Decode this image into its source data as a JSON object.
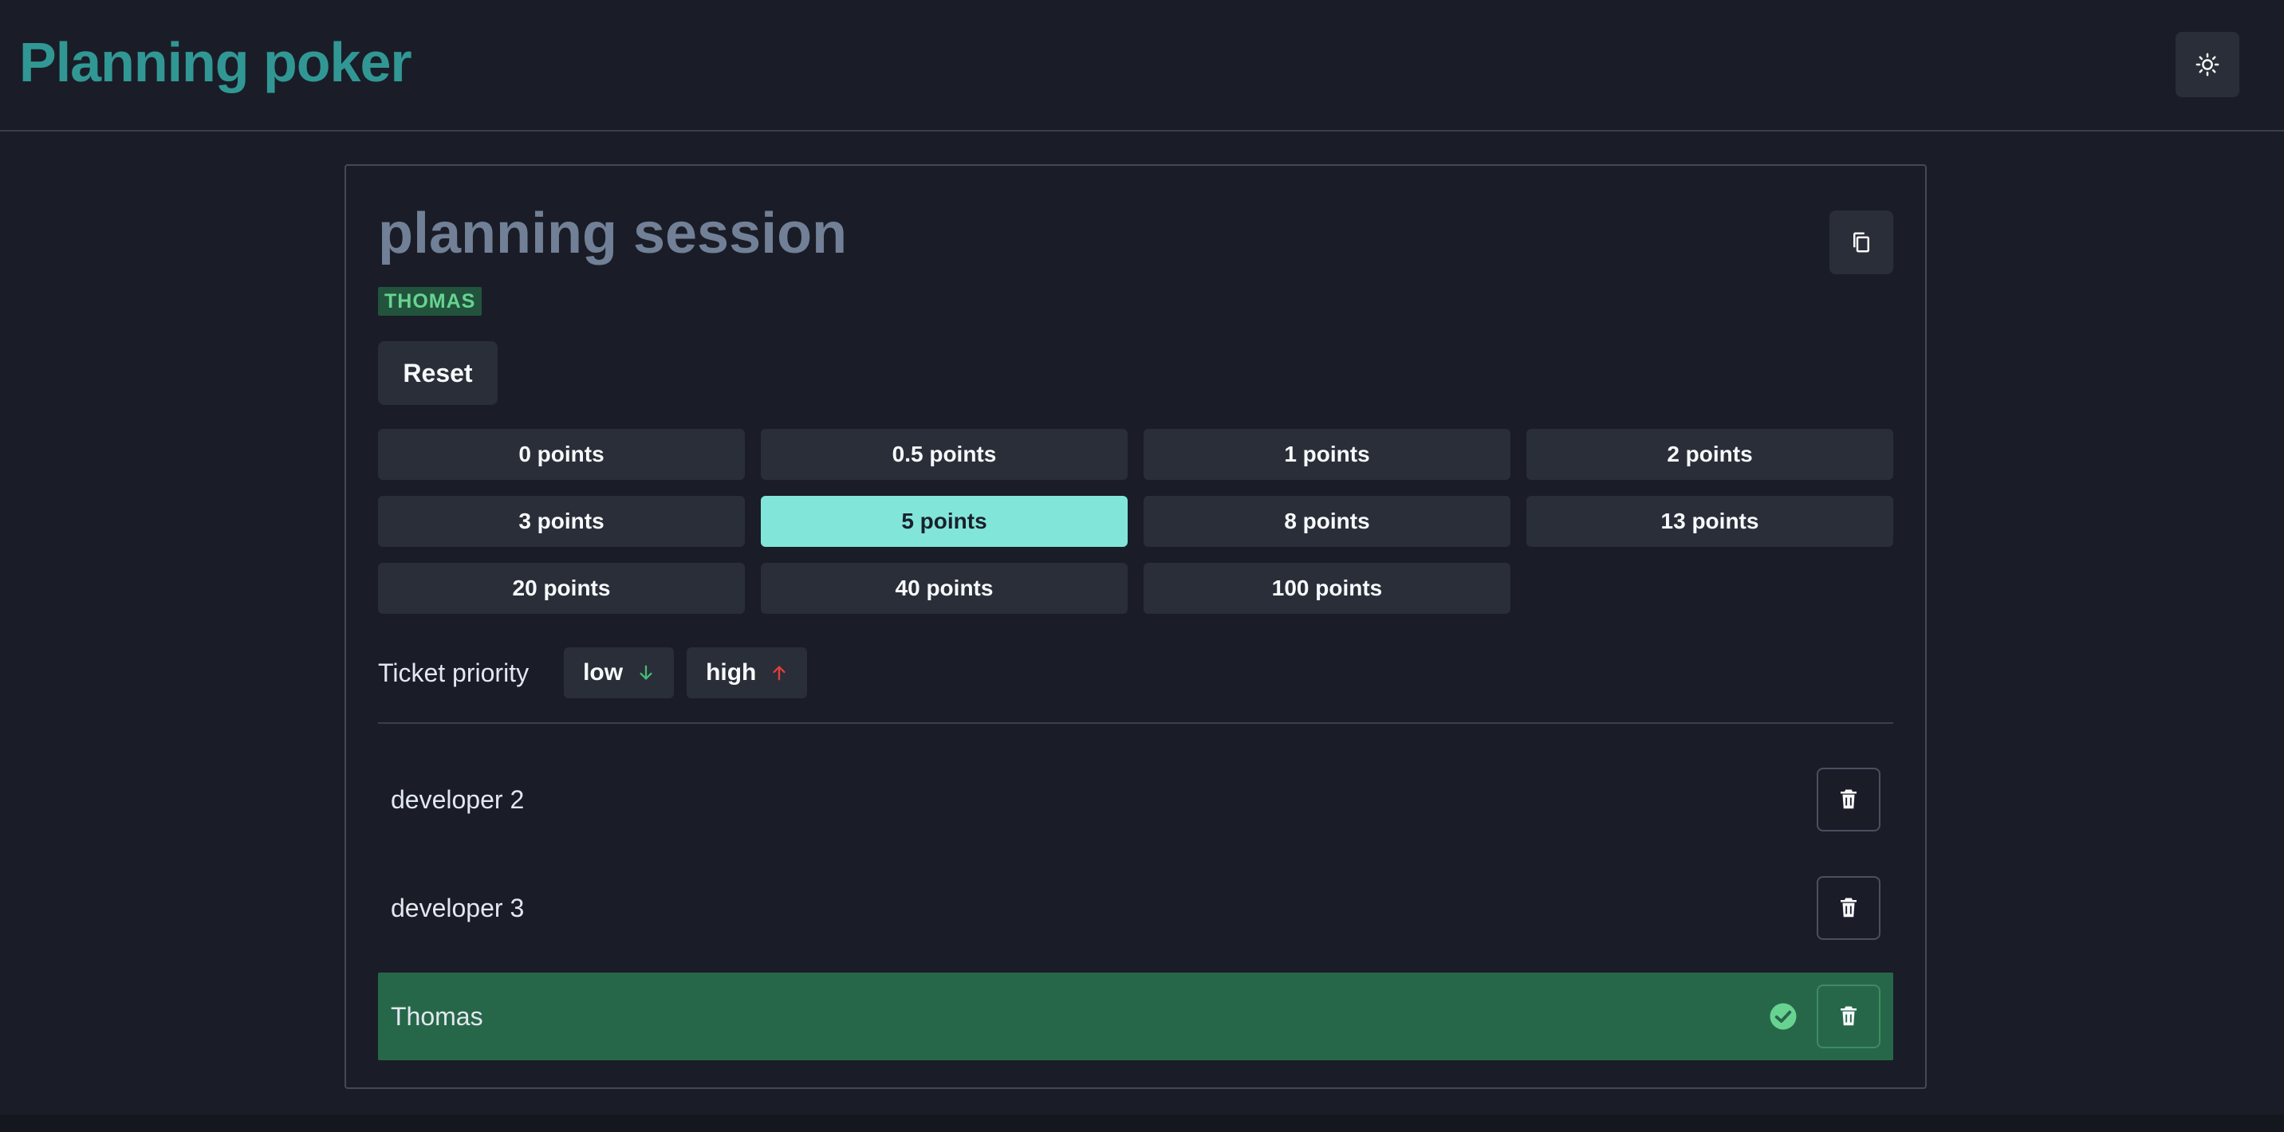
{
  "app": {
    "title": "Planning poker"
  },
  "header": {
    "theme_toggle_icon": "sun-icon"
  },
  "session": {
    "title": "planning session",
    "user_badge": "THOMAS",
    "copy_icon": "copy-icon",
    "reset_label": "Reset"
  },
  "points": [
    {
      "label": "0 points",
      "selected": false
    },
    {
      "label": "0.5 points",
      "selected": false
    },
    {
      "label": "1 points",
      "selected": false
    },
    {
      "label": "2 points",
      "selected": false
    },
    {
      "label": "3 points",
      "selected": false
    },
    {
      "label": "5 points",
      "selected": true
    },
    {
      "label": "8 points",
      "selected": false
    },
    {
      "label": "13 points",
      "selected": false
    },
    {
      "label": "20 points",
      "selected": false
    },
    {
      "label": "40 points",
      "selected": false
    },
    {
      "label": "100 points",
      "selected": false
    }
  ],
  "priority": {
    "label": "Ticket priority",
    "low_label": "low",
    "high_label": "high",
    "low_color": "#48bb78",
    "high_color": "#e53e3e"
  },
  "participants": [
    {
      "name": "developer 2",
      "voted": false
    },
    {
      "name": "developer 3",
      "voted": false
    },
    {
      "name": "Thomas",
      "voted": true
    }
  ],
  "colors": {
    "accent": "#319795",
    "selected_point": "#81e6d9",
    "voted_row": "#276749",
    "background": "#1a1d27"
  }
}
